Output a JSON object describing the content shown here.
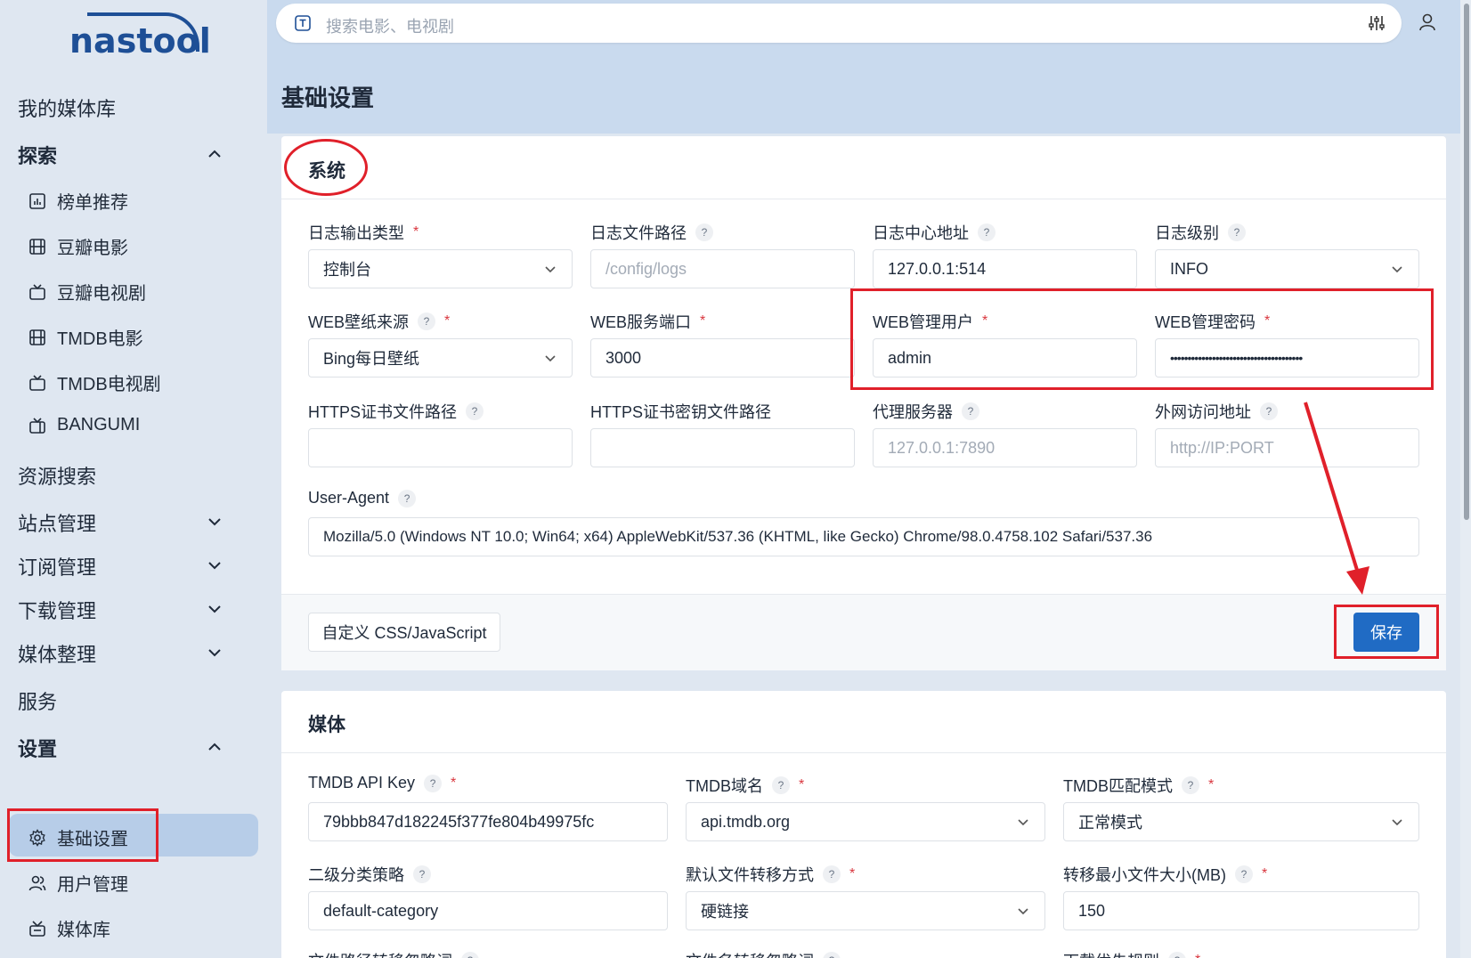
{
  "app": {
    "logo_text": "nastool"
  },
  "search": {
    "placeholder": "搜索电影、电视剧"
  },
  "sidebar": {
    "library": "我的媒体库",
    "explore": {
      "title": "探索",
      "items": [
        "榜单推荐",
        "豆瓣电影",
        "豆瓣电视剧",
        "TMDB电影",
        "TMDB电视剧",
        "BANGUMI"
      ]
    },
    "resource_search": "资源搜索",
    "site_manage": "站点管理",
    "subscribe_manage": "订阅管理",
    "download_manage": "下载管理",
    "media_organize": "媒体整理",
    "services": "服务",
    "settings": {
      "title": "设置",
      "items": [
        "基础设置",
        "用户管理",
        "媒体库"
      ]
    }
  },
  "page": {
    "title": "基础设置"
  },
  "system": {
    "title": "系统",
    "log_type": {
      "label": "日志输出类型",
      "value": "控制台"
    },
    "log_path": {
      "label": "日志文件路径",
      "placeholder": "/config/logs"
    },
    "log_center": {
      "label": "日志中心地址",
      "value": "127.0.0.1:514"
    },
    "log_level": {
      "label": "日志级别",
      "value": "INFO"
    },
    "wallpaper": {
      "label": "WEB壁纸来源",
      "value": "Bing每日壁纸"
    },
    "web_port": {
      "label": "WEB服务端口",
      "value": "3000"
    },
    "web_user": {
      "label": "WEB管理用户",
      "value": "admin"
    },
    "web_password": {
      "label": "WEB管理密码",
      "value": "••••••••••••••••••••••••••••••••••••••"
    },
    "https_cert": {
      "label": "HTTPS证书文件路径",
      "value": ""
    },
    "https_key": {
      "label": "HTTPS证书密钥文件路径",
      "value": ""
    },
    "proxy": {
      "label": "代理服务器",
      "placeholder": "127.0.0.1:7890"
    },
    "external_url": {
      "label": "外网访问地址",
      "placeholder": "http://IP:PORT"
    },
    "user_agent": {
      "label": "User-Agent",
      "value": "Mozilla/5.0 (Windows NT 10.0; Win64; x64) AppleWebKit/537.36 (KHTML, like Gecko) Chrome/98.0.4758.102 Safari/537.36"
    },
    "custom_css_button": "自定义 CSS/JavaScript",
    "save_button": "保存"
  },
  "media": {
    "title": "媒体",
    "tmdb_key": {
      "label": "TMDB API Key",
      "value": "79bbb847d182245f377fe804b49975fc"
    },
    "tmdb_domain": {
      "label": "TMDB域名",
      "value": "api.tmdb.org"
    },
    "tmdb_match": {
      "label": "TMDB匹配模式",
      "value": "正常模式"
    },
    "category": {
      "label": "二级分类策略",
      "value": "default-category"
    },
    "transfer_mode": {
      "label": "默认文件转移方式",
      "value": "硬链接"
    },
    "min_size": {
      "label": "转移最小文件大小(MB)",
      "value": "150"
    },
    "row4_labels": [
      "文件路径转移忽略词",
      "文件名转移忽略词",
      "下载优先规则"
    ]
  },
  "help_mark": "?",
  "required_mark": "*",
  "colors": {
    "accent": "#206bc4",
    "annotation": "#e0202a",
    "sidebar_bg": "#dfe7f1"
  }
}
